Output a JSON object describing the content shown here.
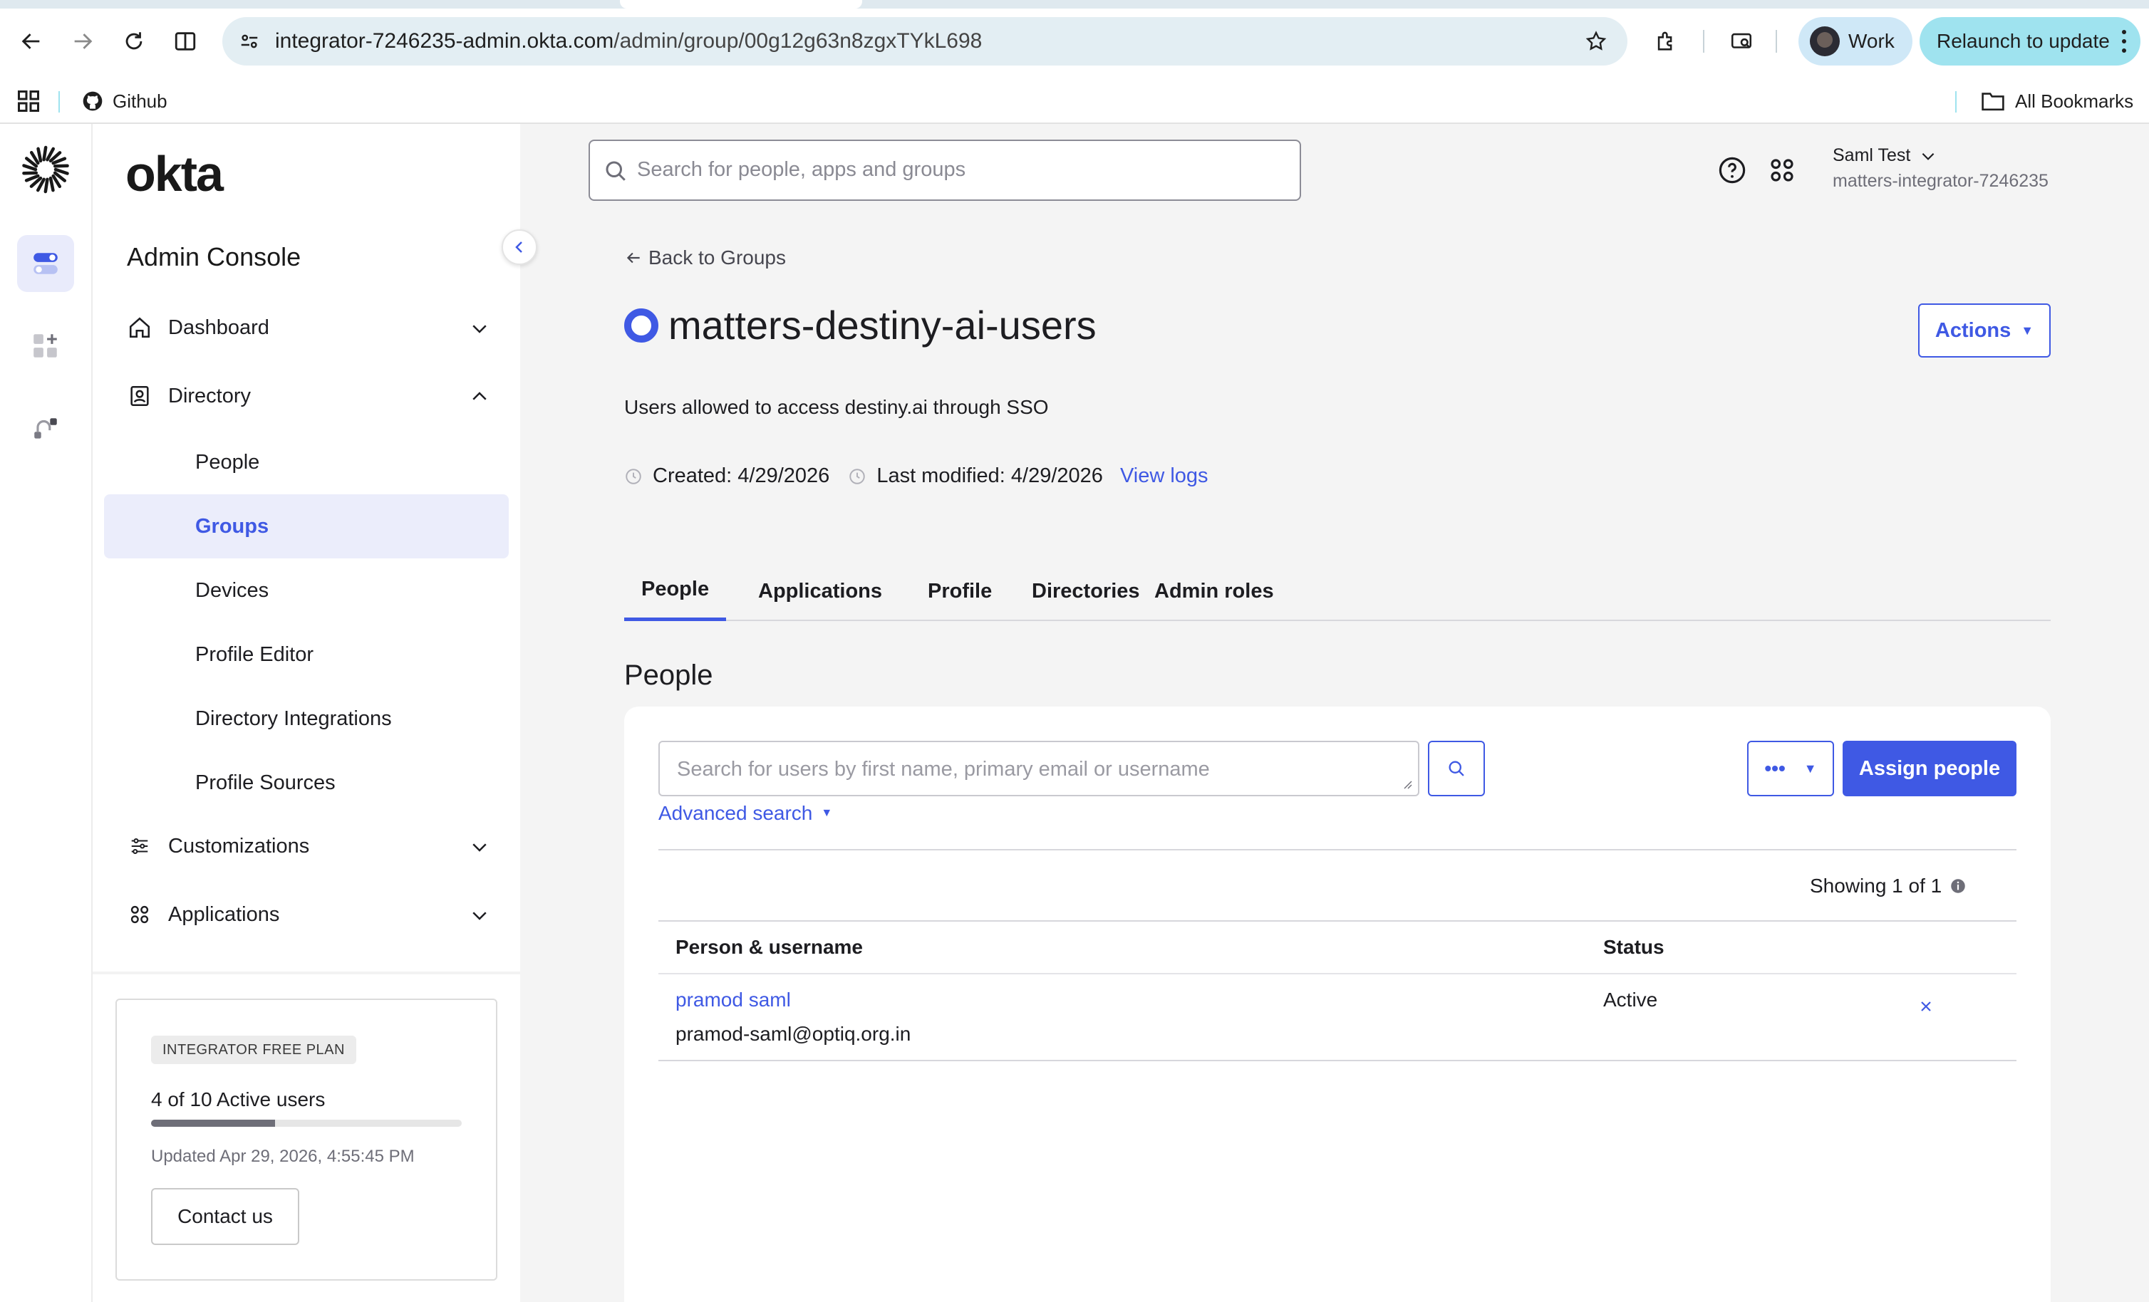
{
  "browser": {
    "url_host": "integrator-7246235-admin.okta.com",
    "url_path": "/admin/group/00g12g63n8zgxTYkL698",
    "profile_label": "Work",
    "relaunch_label": "Relaunch to update",
    "bookmarks": {
      "github_label": "Github",
      "all_bookmarks_label": "All Bookmarks"
    }
  },
  "sidebar": {
    "brand": "okta",
    "console_title": "Admin Console",
    "nav": {
      "dashboard": "Dashboard",
      "directory": "Directory",
      "customizations": "Customizations",
      "applications": "Applications"
    },
    "directory_items": [
      "People",
      "Groups",
      "Devices",
      "Profile Editor",
      "Directory Integrations",
      "Profile Sources"
    ],
    "active_item": "Groups",
    "plan": {
      "badge": "INTEGRATOR FREE PLAN",
      "users_text": "4 of 10 Active users",
      "users_active": 4,
      "users_total": 10,
      "updated_text": "Updated Apr 29, 2026, 4:55:45 PM",
      "contact_label": "Contact us"
    }
  },
  "header": {
    "search_placeholder": "Search for people, apps and groups",
    "user_name": "Saml Test",
    "user_org": "matters-integrator-7246235"
  },
  "group": {
    "back_label": "Back to Groups",
    "name": "matters-destiny-ai-users",
    "actions_label": "Actions",
    "description": "Users allowed to access destiny.ai through SSO",
    "created": "Created: 4/29/2026",
    "modified": "Last modified: 4/29/2026",
    "view_logs": "View logs"
  },
  "tabs": [
    "People",
    "Applications",
    "Profile",
    "Directories",
    "Admin roles"
  ],
  "active_tab": "People",
  "people": {
    "heading": "People",
    "search_placeholder": "Search for users by first name, primary email or username",
    "more_label": "•••",
    "assign_label": "Assign people",
    "advanced_search": "Advanced search",
    "showing": "Showing 1 of 1",
    "columns": [
      "Person & username",
      "Status"
    ],
    "rows": [
      {
        "name": "pramod saml",
        "username": "pramod-saml@optiq.org.in",
        "status": "Active"
      }
    ]
  },
  "colors": {
    "accent": "#3f59e4",
    "relaunch": "#9fe3ef",
    "page_bg": "#f4f4f4"
  }
}
